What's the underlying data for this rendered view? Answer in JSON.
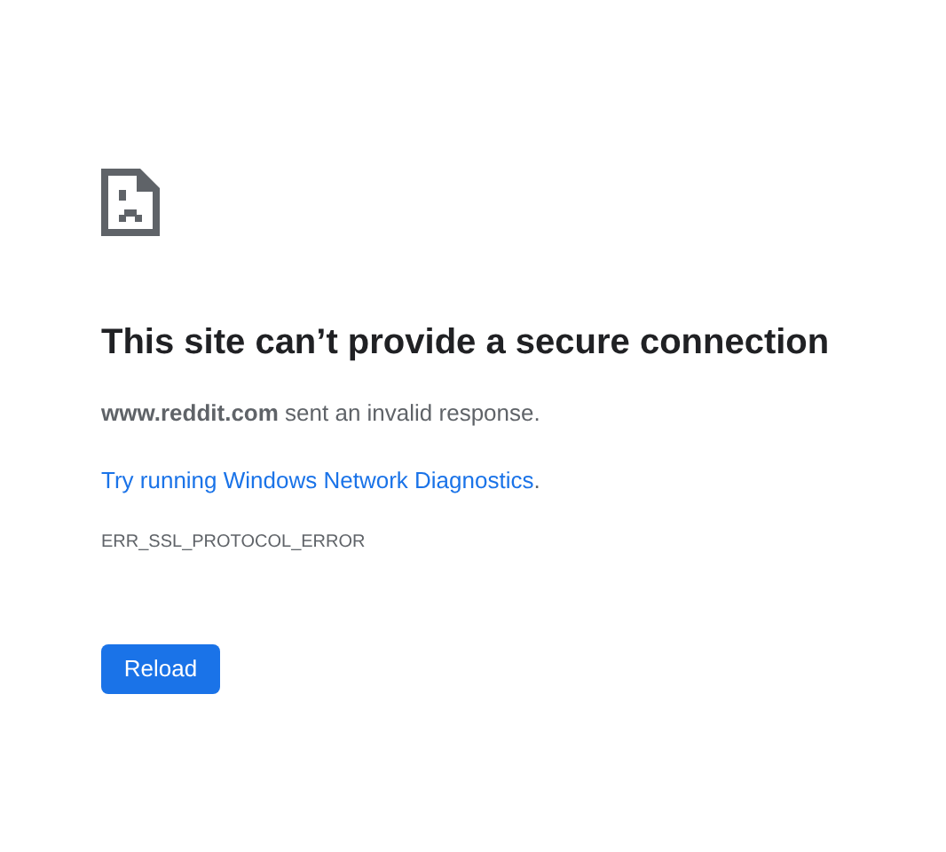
{
  "heading": "This site can’t provide a secure connection",
  "message": "**www.reddit.com** sent an invalid response.",
  "suggestion": {
    "link": "Try running Windows Network Diagnostics",
    "suffix": "."
  },
  "error_code": "ERR_SSL_PROTOCOL_ERROR",
  "button": "Reload"
}
